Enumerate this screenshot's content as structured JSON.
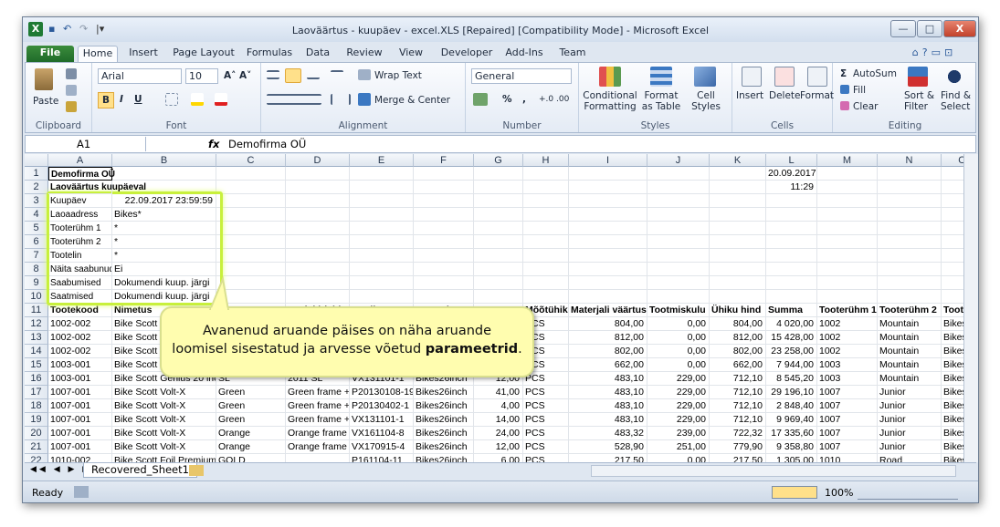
{
  "window": {
    "title": "Laoväärtus - kuupäev - excel.XLS [Repaired]  [Compatibility Mode]  -  Microsoft Excel",
    "minimize": "—",
    "maximize": "□",
    "close": "X"
  },
  "qat": {
    "app_icon": "X",
    "save": "▪",
    "undo": "↶",
    "redo": "↷",
    "customize": "|▾"
  },
  "tabs": [
    "File",
    "Home",
    "Insert",
    "Page Layout",
    "Formulas",
    "Data",
    "Review",
    "View",
    "Developer",
    "Add-Ins",
    "Team"
  ],
  "ribbon": {
    "clipboard": {
      "paste": "Paste",
      "label": "Clipboard"
    },
    "font": {
      "name": "Arial",
      "size": "10",
      "bold": "B",
      "italic": "I",
      "underline": "U",
      "label": "Font"
    },
    "alignment": {
      "wrap": "Wrap Text",
      "merge": "Merge & Center",
      "label": "Alignment"
    },
    "number": {
      "format": "General",
      "percent": "%",
      "comma": ",",
      "label": "Number"
    },
    "styles": {
      "cond": "Conditional",
      "cond2": "Formatting",
      "table": "Format",
      "table2": "as Table",
      "cell": "Cell",
      "cell2": "Styles",
      "label": "Styles"
    },
    "cells": {
      "insert": "Insert",
      "delete": "Delete",
      "format": "Format",
      "label": "Cells"
    },
    "editing": {
      "autosum": "AutoSum",
      "fill": "Fill",
      "clear": "Clear",
      "sort": "Sort &",
      "sort2": "Filter",
      "find": "Find &",
      "find2": "Select",
      "label": "Editing"
    }
  },
  "formula_bar": {
    "name_box": "A1",
    "fx": "fx",
    "value": "Demofirma OÜ"
  },
  "columns": [
    "A",
    "B",
    "C",
    "D",
    "E",
    "F",
    "G",
    "H",
    "I",
    "J",
    "K",
    "L",
    "M",
    "N",
    "O"
  ],
  "rows": [
    [
      "Demofirma OÜ",
      "",
      "",
      "",
      "",
      "",
      "",
      "",
      "",
      "",
      "",
      "20.09.2017",
      "",
      "",
      ""
    ],
    [
      "Laoväärtus kuupäeval",
      "",
      "",
      "",
      "",
      "",
      "",
      "",
      "",
      "",
      "",
      "11:29",
      "",
      "",
      ""
    ],
    [
      "Kuupäev",
      "22.09.2017  23:59:59",
      "",
      "",
      "",
      "",
      "",
      "",
      "",
      "",
      "",
      "",
      "",
      "",
      ""
    ],
    [
      "Laoaadress",
      "Bikes*",
      "",
      "",
      "",
      "",
      "",
      "",
      "",
      "",
      "",
      "",
      "",
      "",
      ""
    ],
    [
      "Tooterühm 1",
      "*",
      "",
      "",
      "",
      "",
      "",
      "",
      "",
      "",
      "",
      "",
      "",
      "",
      ""
    ],
    [
      "Tooterühm 2",
      "*",
      "",
      "",
      "",
      "",
      "",
      "",
      "",
      "",
      "",
      "",
      "",
      "",
      ""
    ],
    [
      "Tootelin",
      "*",
      "",
      "",
      "",
      "",
      "",
      "",
      "",
      "",
      "",
      "",
      "",
      "",
      ""
    ],
    [
      "Näita saabunud",
      "Ei",
      "",
      "",
      "",
      "",
      "",
      "",
      "",
      "",
      "",
      "",
      "",
      "",
      ""
    ],
    [
      "Saabumised",
      "Dokumendi kuup. järgi",
      "",
      "",
      "",
      "",
      "",
      "",
      "",
      "",
      "",
      "",
      "",
      "",
      ""
    ],
    [
      "Saatmised",
      "Dokumendi kuup. järgi",
      "",
      "",
      "",
      "",
      "",
      "",
      "",
      "",
      "",
      "",
      "",
      "",
      ""
    ],
    [
      "Tootekood",
      "Nimetus",
      "",
      "Mod. kirjeldus",
      "Partii nr.",
      "Laoaadress",
      "Kogus",
      "Mõõtühik",
      "Materjali väärtus",
      "Tootmiskulu",
      "Ühiku hind",
      "Summa",
      "Tooterühm 1",
      "Tooterühm 2",
      "Tooteli"
    ],
    [
      "1002-002",
      "Bike Scott S",
      "",
      "",
      "",
      "",
      "",
      "PCS",
      "804,00",
      "0,00",
      "804,00",
      "4 020,00",
      "1002",
      "Mountain",
      "Bikes"
    ],
    [
      "1002-002",
      "Bike Scott S",
      "",
      "",
      "",
      "",
      "",
      "PCS",
      "812,00",
      "0,00",
      "812,00",
      "15 428,00",
      "1002",
      "Mountain",
      "Bikes"
    ],
    [
      "1002-002",
      "Bike Scott S",
      "",
      "",
      "",
      "",
      "",
      "PCS",
      "802,00",
      "0,00",
      "802,00",
      "23 258,00",
      "1002",
      "Mountain",
      "Bikes"
    ],
    [
      "1003-001",
      "Bike Scott G",
      "",
      "",
      "",
      "",
      "",
      "PCS",
      "662,00",
      "0,00",
      "662,00",
      "7 944,00",
      "1003",
      "Mountain",
      "Bikes"
    ],
    [
      "1003-001",
      "Bike Scott Genius 20 inch",
      "SL",
      "2011 SL",
      "VX131101-1",
      "Bikes26inch",
      "12,00",
      "PCS",
      "483,10",
      "229,00",
      "712,10",
      "8 545,20",
      "1003",
      "Mountain",
      "Bikes"
    ],
    [
      "1007-001",
      "Bike Scott Volt-X",
      "Green",
      "Green frame + (",
      "P20130108-19",
      "Bikes26inch",
      "41,00",
      "PCS",
      "483,10",
      "229,00",
      "712,10",
      "29 196,10",
      "1007",
      "Junior",
      "Bikes"
    ],
    [
      "1007-001",
      "Bike Scott Volt-X",
      "Green",
      "Green frame + (",
      "P20130402-1",
      "Bikes26inch",
      "4,00",
      "PCS",
      "483,10",
      "229,00",
      "712,10",
      "2 848,40",
      "1007",
      "Junior",
      "Bikes"
    ],
    [
      "1007-001",
      "Bike Scott Volt-X",
      "Green",
      "Green frame + (",
      "VX131101-1",
      "Bikes26inch",
      "14,00",
      "PCS",
      "483,10",
      "229,00",
      "712,10",
      "9 969,40",
      "1007",
      "Junior",
      "Bikes"
    ],
    [
      "1007-001",
      "Bike Scott Volt-X",
      "Orange",
      "Orange frame +",
      "VX161104-8",
      "Bikes26inch",
      "24,00",
      "PCS",
      "483,32",
      "239,00",
      "722,32",
      "17 335,60",
      "1007",
      "Junior",
      "Bikes"
    ],
    [
      "1007-001",
      "Bike Scott Volt-X",
      "Orange",
      "Orange frame +",
      "VX170915-4",
      "Bikes26inch",
      "12,00",
      "PCS",
      "528,90",
      "251,00",
      "779,90",
      "9 358,80",
      "1007",
      "Junior",
      "Bikes"
    ],
    [
      "1010-002",
      "Bike Scott Foil Premium",
      "GOLD",
      "",
      "P161104-11",
      "Bikes26inch",
      "6,00",
      "PCS",
      "217,50",
      "0,00",
      "217,50",
      "1 305,00",
      "1010",
      "Road",
      "Bikes"
    ]
  ],
  "sheet_tab": "Recovered_Sheet1",
  "status": {
    "ready": "Ready",
    "zoom": "100%"
  },
  "callout": {
    "line1": "Avanenud aruande päises on näha aruande",
    "line2a": "loomisel sisestatud ja arvesse võetud ",
    "line2b": "parameetrid",
    "line2c": "."
  }
}
